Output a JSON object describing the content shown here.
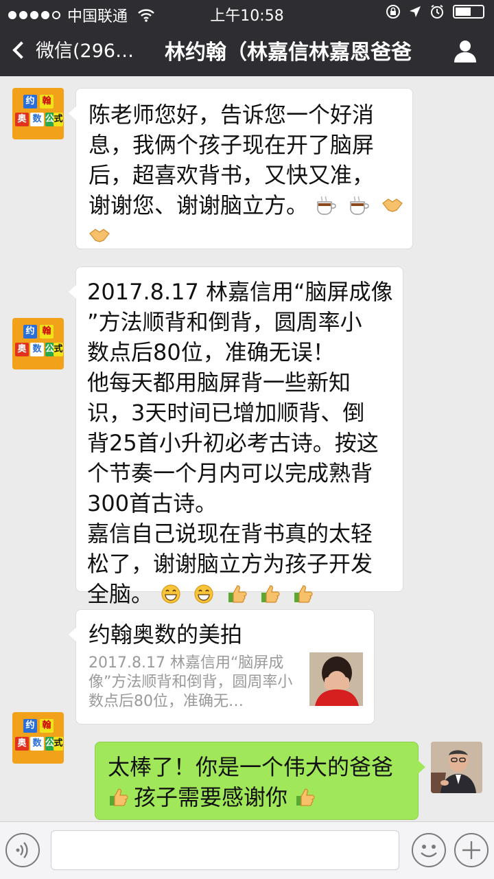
{
  "status": {
    "carrier": "中国联通",
    "time": "上午10:58"
  },
  "nav": {
    "back_label": "微信(296…",
    "title": "林约翰（林嘉信林嘉恩爸爸"
  },
  "logo_chars": [
    "约",
    "翰",
    "奥",
    "数",
    "公",
    "式"
  ],
  "messages": [
    {
      "lines": [
        "陈老师您好，告诉您一个好消",
        "息，我俩个孩子现在开了脑屏",
        "后，超喜欢背书，又快又准，",
        "谢谢您、谢谢脑立方。"
      ]
    },
    {
      "lines": [
        "2017.8.17 林嘉信用“脑屏成像",
        "”方法顺背和倒背，圆周率小",
        "数点后80位，准确无误！",
        "他每天都用脑屏背一些新知",
        "识，3天时间已增加顺背、倒",
        "背25首小升初必考古诗。按这",
        "个节奏一个月内可以完成熟背",
        "300首古诗。",
        "嘉信自己说现在背书真的太轻",
        "松了，谢谢脑立方为孩子开发",
        "全脑。"
      ]
    },
    {
      "link_title": "约翰奥数的美拍",
      "link_desc": "2017.8.17 林嘉信用“脑屏成像”方法顺背和倒背，圆周率小数点后80位，准确无…"
    },
    {
      "lines": [
        "太棒了！你是一个伟大的爸爸",
        "孩子需要感谢你"
      ]
    }
  ],
  "colors": {
    "nav": "#2e2e32",
    "chat_bg": "#ebebeb",
    "sent_bubble": "#a0e75a"
  }
}
